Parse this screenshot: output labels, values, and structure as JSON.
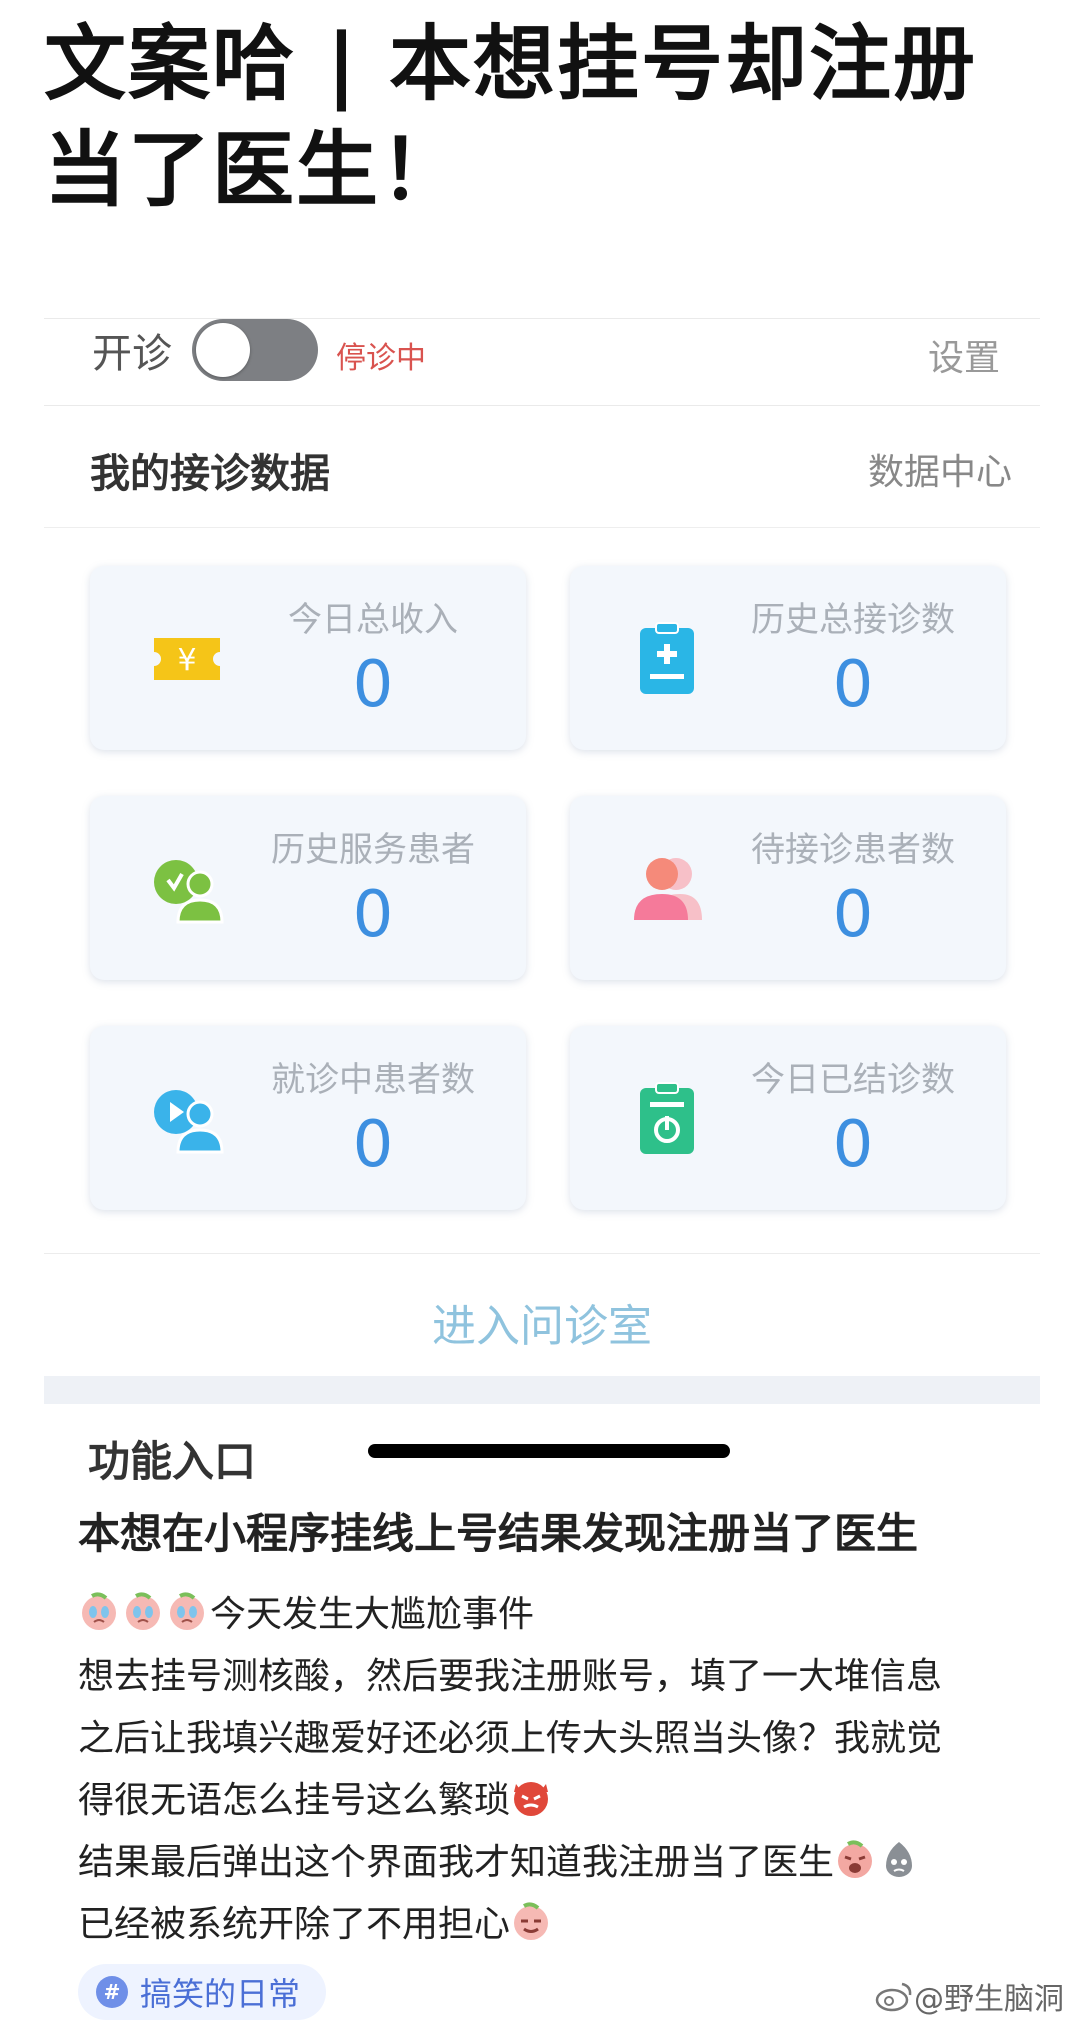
{
  "headline": "文案哈 | 本想挂号却注册当了医生！",
  "status_bar": {
    "open_label": "开诊",
    "status_text": "停诊中",
    "settings_label": "设置",
    "toggle_on": false
  },
  "data_section": {
    "title": "我的接诊数据",
    "link": "数据中心"
  },
  "cards": [
    {
      "label": "今日总收入",
      "value": "0",
      "icon": "yuan-ticket-icon",
      "color": "#f5c518"
    },
    {
      "label": "历史总接诊数",
      "value": "0",
      "icon": "clipboard-plus-icon",
      "color": "#2ab6e6"
    },
    {
      "label": "历史服务患者",
      "value": "0",
      "icon": "patients-served-icon",
      "color": "#7cc142"
    },
    {
      "label": "待接诊患者数",
      "value": "0",
      "icon": "waiting-patient-icon",
      "color": "#f58a7a"
    },
    {
      "label": "就诊中患者数",
      "value": "0",
      "icon": "in-consultation-icon",
      "color": "#3ab3ea"
    },
    {
      "label": "今日已结诊数",
      "value": "0",
      "icon": "clipboard-done-icon",
      "color": "#2ec08a"
    }
  ],
  "enter_room": "进入问诊室",
  "function_entry": "功能入口",
  "post": {
    "title": "本想在小程序挂线上号结果发现注册当了医生",
    "line1": "今天发生大尴尬事件",
    "line2": "想去挂号测核酸，然后要我注册账号，填了一大堆信息",
    "line3": "之后让我填兴趣爱好还必须上传大头照当头像？我就觉",
    "line4": "得很无语怎么挂号这么繁琐",
    "line5": "结果最后弹出这个界面我才知道我注册当了医生",
    "line6": "已经被系统开除了不用担心"
  },
  "tag": {
    "symbol": "#",
    "text": "搞笑的日常"
  },
  "watermark": "@野生脑洞",
  "accent": "#3d8fe0"
}
